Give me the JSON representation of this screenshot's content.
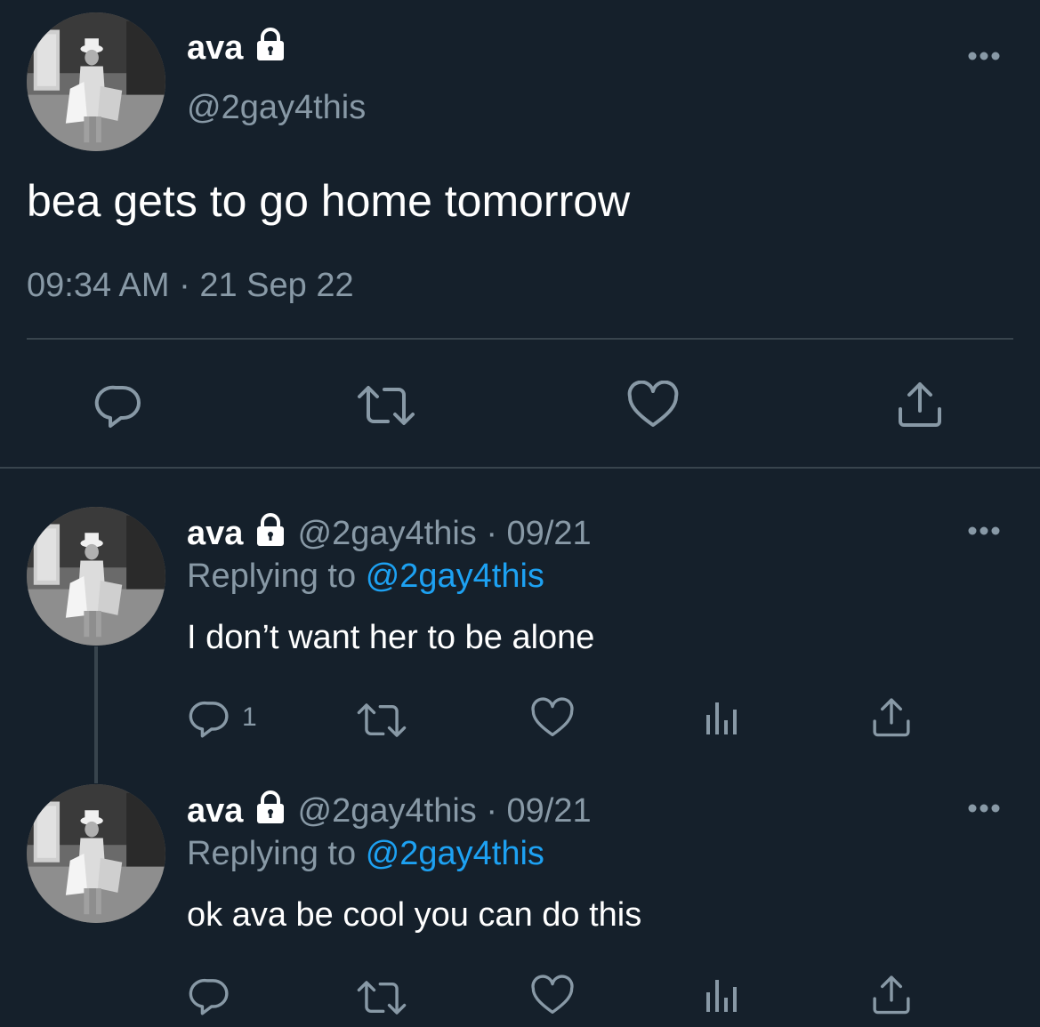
{
  "tweet": {
    "name": "ava",
    "handle": "@2gay4this",
    "text": "bea gets to go home tomorrow",
    "timestamp": "09:34 AM · 21 Sep 22",
    "actions": [
      "reply-icon",
      "retweet-icon",
      "like-icon",
      "share-icon"
    ]
  },
  "replies": [
    {
      "name": "ava",
      "meta": "@2gay4this · 09/21",
      "replying_label": "Replying to",
      "mention": "@2gay4this",
      "text": "I don’t want her to be alone",
      "reply_count": "1",
      "actions": [
        "reply-icon",
        "retweet-icon",
        "like-icon",
        "analytics-icon",
        "share-icon"
      ]
    },
    {
      "name": "ava",
      "meta": "@2gay4this · 09/21",
      "replying_label": "Replying to",
      "mention": "@2gay4this",
      "text": "ok ava be cool you can do this",
      "actions": [
        "reply-icon",
        "retweet-icon",
        "like-icon",
        "analytics-icon",
        "share-icon"
      ]
    }
  ],
  "colors": {
    "background": "#15202b",
    "secondary_text": "#8899a6",
    "link": "#1da1f2",
    "divider": "#38444d"
  }
}
